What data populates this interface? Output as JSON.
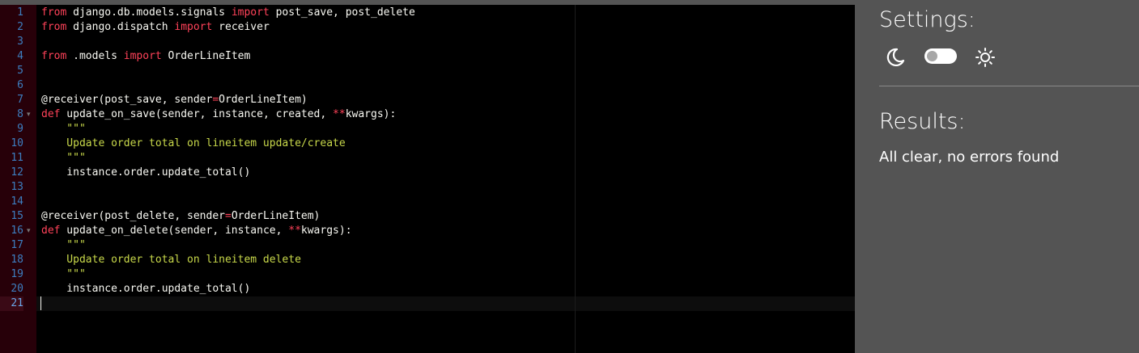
{
  "editor": {
    "line_numbers": [
      "1",
      "2",
      "3",
      "4",
      "5",
      "6",
      "7",
      "8",
      "9",
      "10",
      "11",
      "12",
      "13",
      "14",
      "15",
      "16",
      "17",
      "18",
      "19",
      "20",
      "21"
    ],
    "current_line": "21",
    "fold_markers": [
      "8",
      "16"
    ],
    "lines": [
      [
        [
          "kw",
          "from"
        ],
        [
          "plain",
          " django.db.models.signals "
        ],
        [
          "kw",
          "import"
        ],
        [
          "plain",
          " post_save, post_delete"
        ]
      ],
      [
        [
          "kw",
          "from"
        ],
        [
          "plain",
          " django.dispatch "
        ],
        [
          "kw",
          "import"
        ],
        [
          "plain",
          " receiver"
        ]
      ],
      [],
      [
        [
          "kw",
          "from"
        ],
        [
          "plain",
          " .models "
        ],
        [
          "kw",
          "import"
        ],
        [
          "plain",
          " OrderLineItem"
        ]
      ],
      [],
      [],
      [
        [
          "plain",
          "@receiver(post_save, sender"
        ],
        [
          "kw",
          "="
        ],
        [
          "plain",
          "OrderLineItem)"
        ]
      ],
      [
        [
          "kw",
          "def"
        ],
        [
          "plain",
          " update_on_save(sender, instance, created, "
        ],
        [
          "kw",
          "**"
        ],
        [
          "plain",
          "kwargs):"
        ]
      ],
      [
        [
          "str",
          "    \"\"\""
        ]
      ],
      [
        [
          "str",
          "    Update order total on lineitem update/create"
        ]
      ],
      [
        [
          "str",
          "    \"\"\""
        ]
      ],
      [
        [
          "plain",
          "    instance.order.update_total()"
        ]
      ],
      [],
      [],
      [
        [
          "plain",
          "@receiver(post_delete, sender"
        ],
        [
          "kw",
          "="
        ],
        [
          "plain",
          "OrderLineItem)"
        ]
      ],
      [
        [
          "kw",
          "def"
        ],
        [
          "plain",
          " update_on_delete(sender, instance, "
        ],
        [
          "kw",
          "**"
        ],
        [
          "plain",
          "kwargs):"
        ]
      ],
      [
        [
          "str",
          "    \"\"\""
        ]
      ],
      [
        [
          "str",
          "    Update order total on lineitem delete"
        ]
      ],
      [
        [
          "str",
          "    \"\"\""
        ]
      ],
      [
        [
          "plain",
          "    instance.order.update_total()"
        ]
      ],
      []
    ],
    "colors": {
      "background": "#000000",
      "gutter": "#270009",
      "keyword": "#ff4259",
      "string": "#c8d84a",
      "text": "#f8f8f2",
      "line_number": "#3d7ec0"
    }
  },
  "panel": {
    "settings_title": "Settings:",
    "moon_icon": "moon-icon",
    "theme_toggle": "off",
    "sun_icon": "sun-icon",
    "results_title": "Results:",
    "results_message": "All clear, no errors found"
  }
}
